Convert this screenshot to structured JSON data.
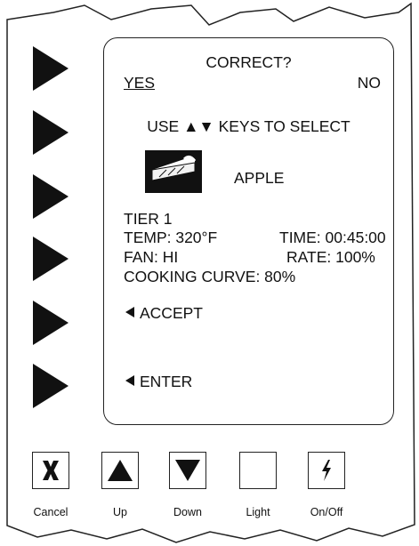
{
  "screen": {
    "title": "CORRECT?",
    "yes": "YES",
    "no": "NO",
    "instruction": "USE ▲▼ KEYS TO SELECT",
    "product_icon": "pie-icon",
    "product_name": "APPLE",
    "tier": "TIER 1",
    "temp": "TEMP: 320°F",
    "time": "TIME: 00:45:00",
    "fan": "FAN: HI",
    "rate": "RATE: 100%",
    "curve": "COOKING CURVE: 80%",
    "accept": "ACCEPT",
    "enter": "ENTER"
  },
  "side_buttons": {
    "count": 6,
    "icon": "triangle-right-icon"
  },
  "keys": {
    "cancel": {
      "label": "Cancel",
      "icon": "x-icon"
    },
    "up": {
      "label": "Up",
      "icon": "up-triangle-icon"
    },
    "down": {
      "label": "Down",
      "icon": "down-triangle-icon"
    },
    "light": {
      "label": "Light",
      "icon": ""
    },
    "onoff": {
      "label": "On/Off",
      "icon": "lightning-icon"
    }
  }
}
